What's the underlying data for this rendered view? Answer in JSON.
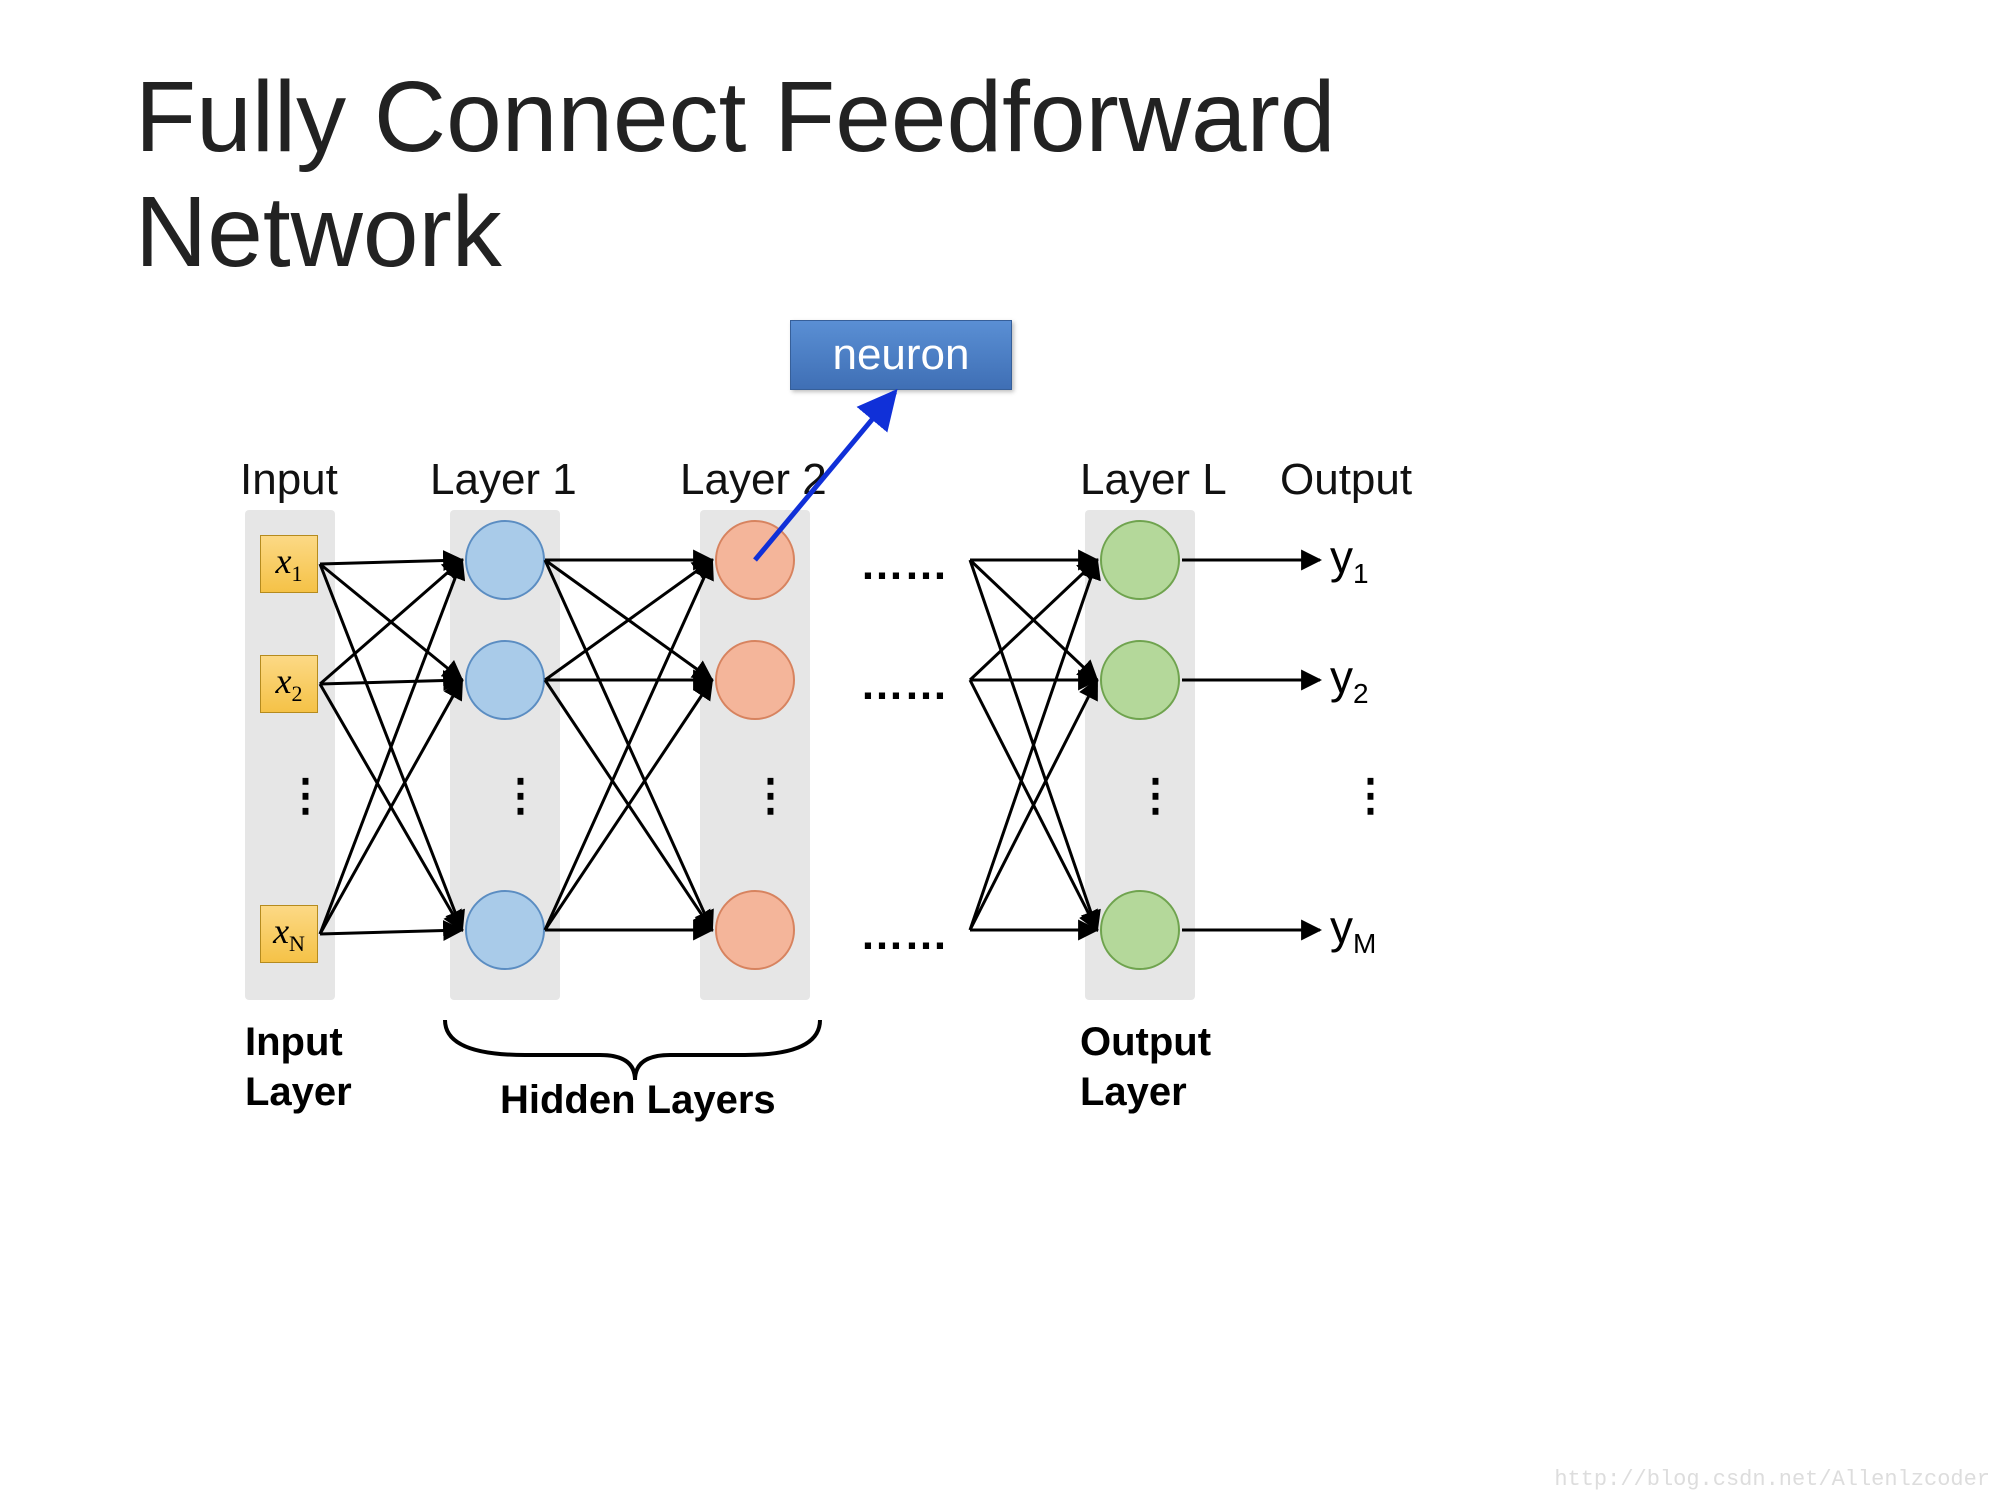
{
  "title_line1": "Fully Connect Feedforward",
  "title_line2": "Network",
  "callout": "neuron",
  "col_labels": {
    "input": "Input",
    "layer1": "Layer 1",
    "layer2": "Layer 2",
    "layerL": "Layer L",
    "output": "Output"
  },
  "input_nodes": {
    "x1": "x",
    "x1_sub": "1",
    "x2": "x",
    "x2_sub": "2",
    "xN": "x",
    "xN_sub": "N"
  },
  "output_nodes": {
    "y1": "y",
    "y1_sub": "1",
    "y2": "y",
    "y2_sub": "2",
    "yM": "y",
    "yM_sub": "M"
  },
  "ellipsis": "……",
  "bottom_labels": {
    "input_layer_l1": "Input",
    "input_layer_l2": "Layer",
    "hidden": "Hidden Layers",
    "output_layer_l1": "Output",
    "output_layer_l2": "Layer"
  },
  "watermark": "http://blog.csdn.net/Allenlzcoder"
}
